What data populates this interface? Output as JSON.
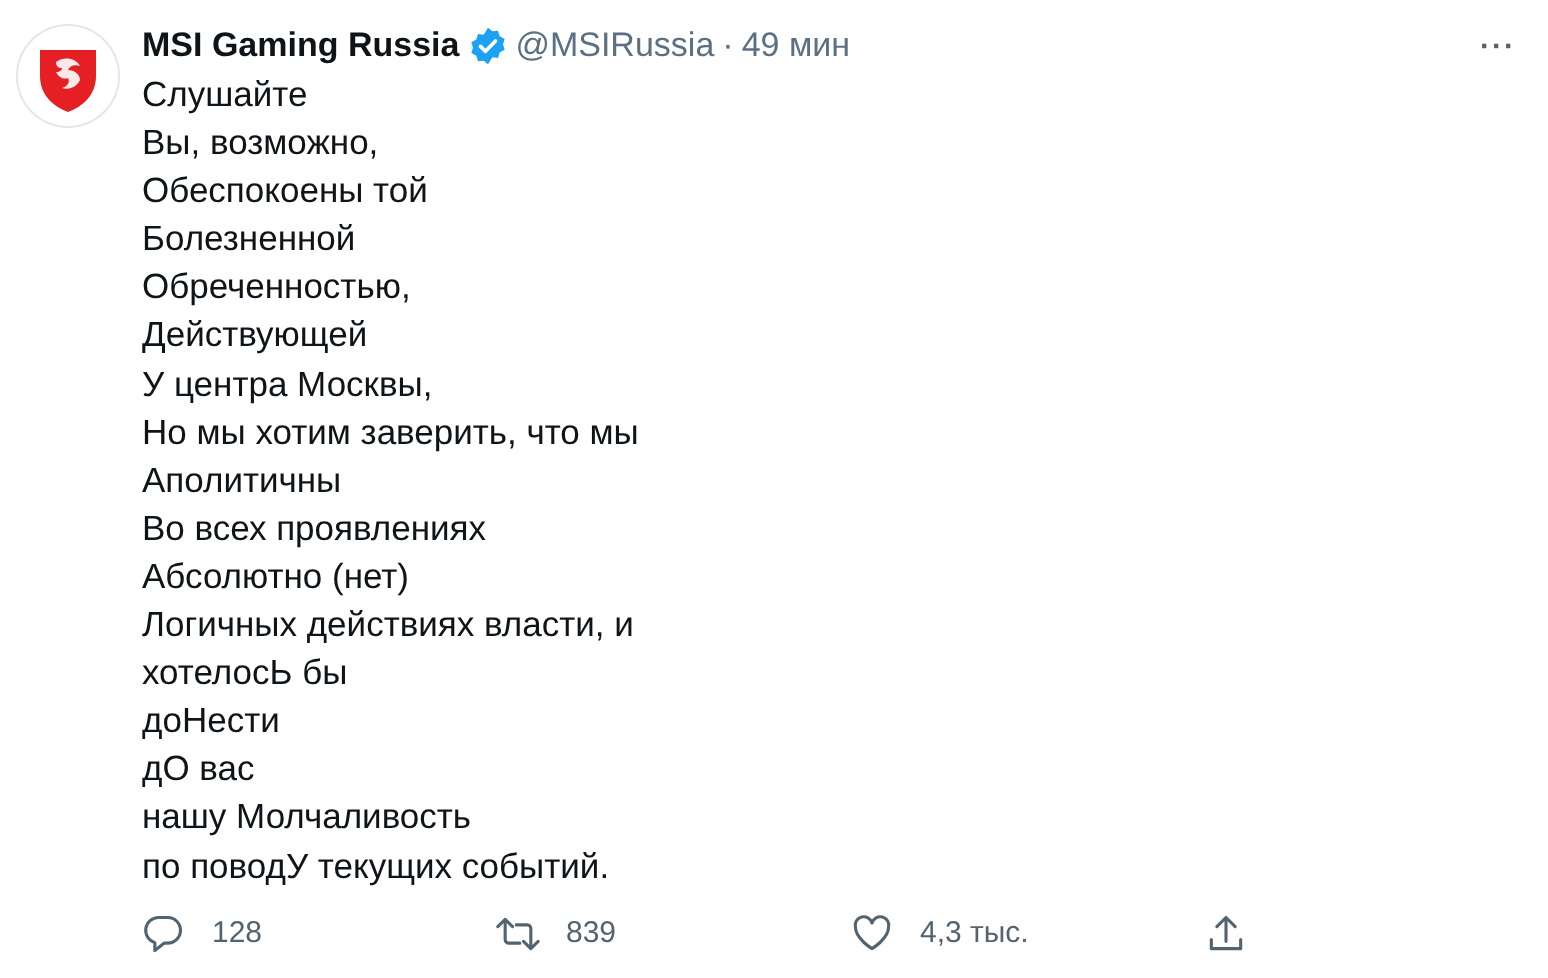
{
  "tweet": {
    "author": "MSI Gaming Russia",
    "verified": true,
    "handle": "@MSIRussia",
    "separator": "·",
    "time": "49 мин",
    "more": "···",
    "lines": [
      "Слушайте",
      "Вы, возможно,",
      "Обеспокоены той",
      "Болезненной",
      "Обреченностью,",
      "Действующей",
      "У центра Москвы,",
      "Но мы хотим заверить, что мы",
      "Аполитичны",
      "Во всех проявлениях",
      "Абсолютно (нет)",
      "Логичных действиях власти, и",
      "хотелосЬ бы",
      "доНести",
      "дО вас",
      "нашу Молчаливость",
      "по поводУ текущих событий."
    ],
    "actions": [
      {
        "kind": "reply",
        "count": "128"
      },
      {
        "kind": "retweet",
        "count": "839"
      },
      {
        "kind": "like",
        "count": "4,3 тыс."
      },
      {
        "kind": "share"
      }
    ]
  }
}
